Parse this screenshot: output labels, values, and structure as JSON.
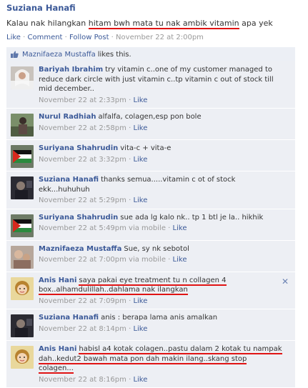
{
  "post": {
    "author": "Suziana Hanafi",
    "text_plain_before": "Kalau nak hilangkan ",
    "text_underlined": "hitam bwh mata tu nak ambik vitamin",
    "text_plain_after": " apa yek",
    "actions": {
      "like": "Like",
      "sep1": " · ",
      "comment": "Comment",
      "sep2": " · ",
      "follow": "Follow Post",
      "sep3": " · ",
      "timestamp": "November 22 at 2:00pm"
    }
  },
  "likes": {
    "name": "Maznifaeza Mustaffa",
    "text": "likes this."
  },
  "comments": [
    {
      "name": "Bariyah Ibrahim",
      "text": "try vitamin c..one of my customer managed to reduce dark circle with just vitamin c..tp vitamin c out of stock till mid december..",
      "meta": "November 22 at 2:33pm",
      "sep": " · ",
      "like": "Like",
      "avatar": "bride-photo"
    },
    {
      "name": "Nurul Radhiah",
      "text": "alfalfa, colagen,esp pon bole",
      "meta": "November 22 at 2:58pm",
      "sep": " · ",
      "like": "Like",
      "avatar": "outdoor-photo"
    },
    {
      "name": "Suriyana Shahrudin",
      "text": "vita-c + vita-e",
      "meta": "November 22 at 3:32pm",
      "sep": " · ",
      "like": "Like",
      "avatar": "palestine-flag"
    },
    {
      "name": "Suziana Hanafi",
      "text": "thanks semua.....vitamin c ot of stock ekk...huhuhuh",
      "meta": "November 22 at 5:29pm",
      "sep": " · ",
      "like": "Like",
      "avatar": "dark-photo"
    },
    {
      "name": "Suriyana Shahrudin",
      "text": "sue ada lg kalo nk.. tp 1 btl je la.. hikhik",
      "meta": "November 22 at 5:49pm via mobile",
      "sep": " · ",
      "like": "Like",
      "avatar": "palestine-flag"
    },
    {
      "name": "Maznifaeza Mustaffa",
      "text": "Sue, sy nk sebotol",
      "meta": "November 22 at 7:00pm via mobile",
      "sep": " · ",
      "like": "Like",
      "avatar": "family-photo"
    },
    {
      "name": "Anis Hani",
      "text": "saya pakai eye treatment tu n collagen 4 box..alhamdulillah..dahlama nak ilangkan",
      "meta": "November 22 at 7:09pm",
      "sep": " · ",
      "like": "Like",
      "avatar": "child-photo",
      "underline": true,
      "close": "✕"
    },
    {
      "name": "Suziana Hanafi",
      "text": "anis : berapa lama anis amalkan",
      "meta": "November 22 at 8:14pm",
      "sep": " · ",
      "like": "Like",
      "avatar": "dark-photo"
    },
    {
      "name": "Anis Hani",
      "text": "habisl a4 kotak colagen..pastu dalam 2 kotak tu nampak dah..kedut2 bawah mata pon dah makin ilang..skang stop colagen...",
      "meta": "November 22 at 8:16pm",
      "sep": " · ",
      "like": "Like",
      "avatar": "child-photo",
      "underline": true
    }
  ],
  "colors": {
    "link": "#3b5998",
    "meta": "#999999",
    "comment_bg": "#edeff4",
    "highlight": "#e01414"
  }
}
